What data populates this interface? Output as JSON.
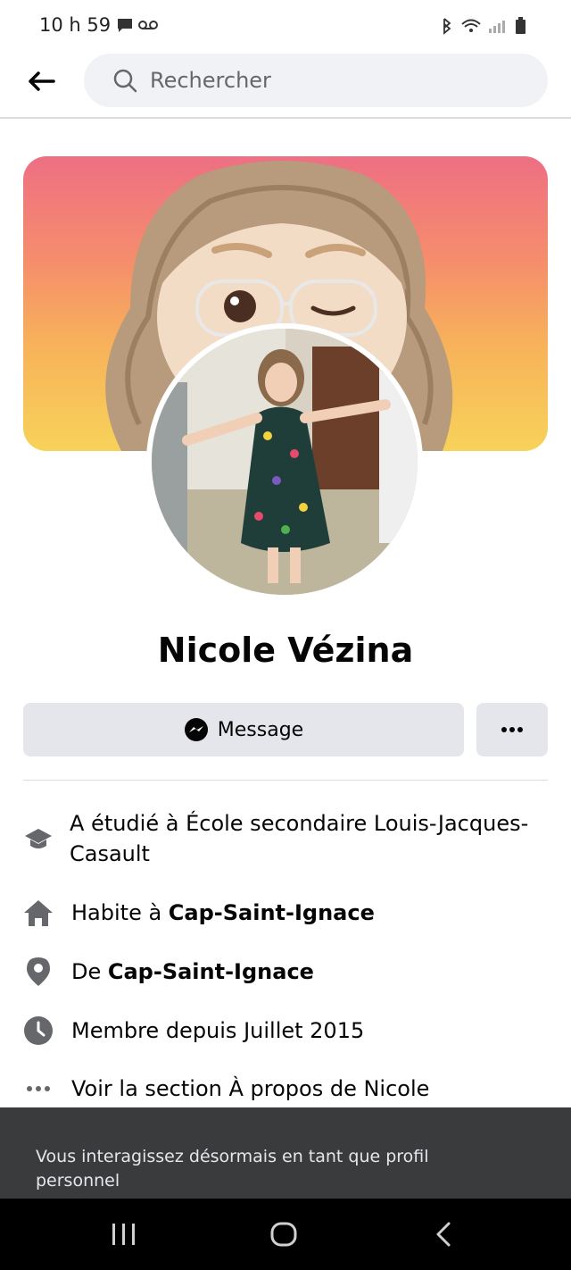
{
  "status_bar": {
    "time": "10 h 59"
  },
  "search": {
    "placeholder": "Rechercher"
  },
  "profile": {
    "name": "Nicole Vézina"
  },
  "actions": {
    "message_label": "Message"
  },
  "info": {
    "studied_prefix": "A étudié à ",
    "studied_school": "École secondaire Louis-Jacques- Casault",
    "lives_prefix": "Habite à ",
    "lives_city": "Cap-Saint-Ignace",
    "from_prefix": "De ",
    "from_city": "Cap-Saint-Ignace",
    "member_since": "Membre depuis Juillet 2015",
    "see_about": "Voir la section À propos de Nicole"
  },
  "toast": {
    "text": "Vous interagissez désormais en tant que profil personnel"
  },
  "colors": {
    "accent": "#050505",
    "button_bg": "#e4e6eb",
    "icon_gray": "#65676b",
    "toast_bg": "#3a3b3c"
  },
  "icons": [
    "back-arrow-icon",
    "search-icon",
    "messenger-icon",
    "more-icon",
    "graduation-cap-icon",
    "home-icon",
    "location-pin-icon",
    "clock-icon",
    "dots-icon"
  ]
}
